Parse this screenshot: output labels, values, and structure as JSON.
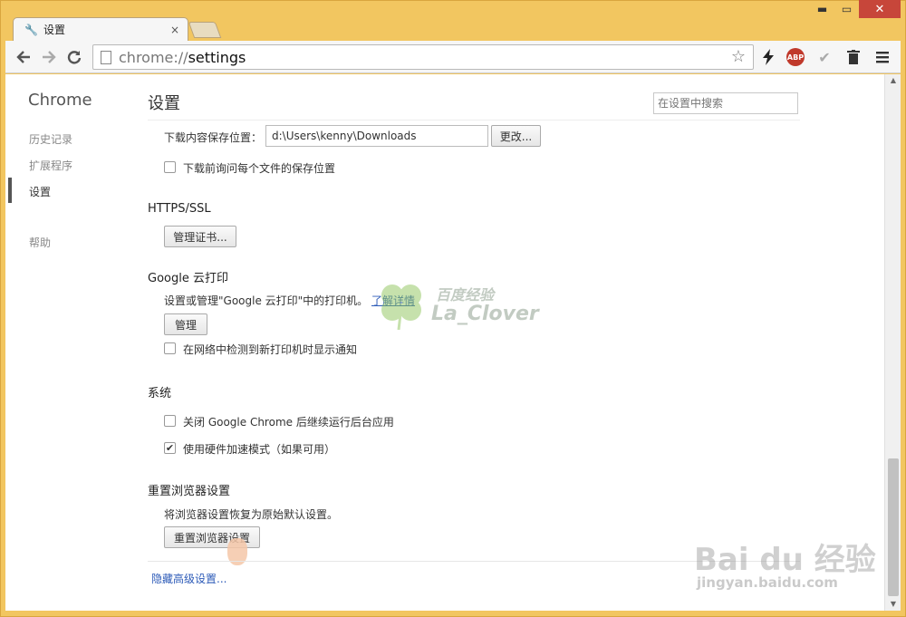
{
  "window": {
    "minimize": "▬",
    "maximize": "▭",
    "close": "✕"
  },
  "tab": {
    "title": "设置",
    "close": "×"
  },
  "omnibox": {
    "scheme": "chrome://",
    "path": "settings"
  },
  "nav": {
    "title": "Chrome",
    "items": [
      {
        "label": "历史记录"
      },
      {
        "label": "扩展程序"
      },
      {
        "label": "设置"
      },
      {
        "label": "帮助"
      }
    ]
  },
  "page": {
    "title": "设置",
    "search_placeholder": "在设置中搜索"
  },
  "downloads": {
    "location_label": "下载内容保存位置：",
    "location_value": "d:\\Users\\kenny\\Downloads",
    "change_button": "更改...",
    "ask_label": "下载前询问每个文件的保存位置",
    "ask_checked": false
  },
  "https": {
    "heading": "HTTPS/SSL",
    "manage_certs_button": "管理证书..."
  },
  "cloud_print": {
    "heading": "Google 云打印",
    "desc": "设置或管理\"Google 云打印\"中的打印机。",
    "learn_more": "了解详情",
    "manage_button": "管理",
    "notify_label": "在网络中检测到新打印机时显示通知",
    "notify_checked": false
  },
  "system": {
    "heading": "系统",
    "bg_apps_label": "关闭 Google Chrome 后继续运行后台应用",
    "bg_apps_checked": false,
    "hw_accel_label": "使用硬件加速模式（如果可用）",
    "hw_accel_checked": true
  },
  "reset": {
    "heading": "重置浏览器设置",
    "desc": "将浏览器设置恢复为原始默认设置。",
    "button": "重置浏览器设置"
  },
  "hide_advanced": "隐藏高级设置...",
  "watermarks": {
    "clover_cn": "百度经验",
    "clover_en": "La_Clover",
    "baidu": "Bai du 经验",
    "baidu_url": "jingyan.baidu.com"
  }
}
